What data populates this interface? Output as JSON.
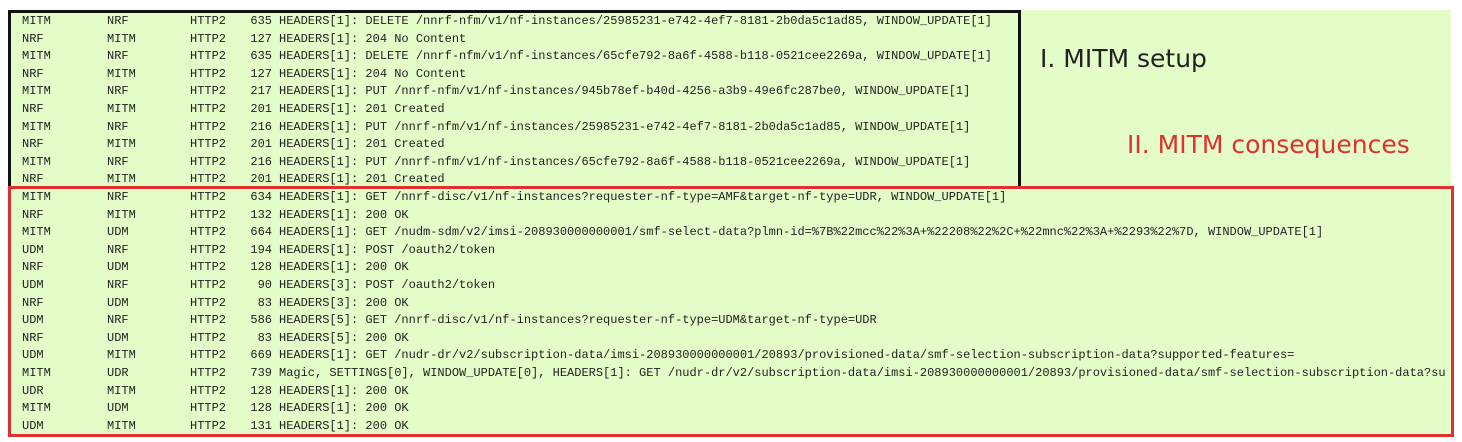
{
  "labels": {
    "setup": "I. MITM setup",
    "consequences": "II. MITM consequences"
  },
  "colors": {
    "background": "#e3fcc8",
    "setup_border": "#111111",
    "consequences_border": "#e03030"
  },
  "setup_packets": [
    {
      "src": "MITM",
      "dst": "NRF",
      "proto": "HTTP2",
      "len": "635",
      "info": "HEADERS[1]: DELETE /nnrf-nfm/v1/nf-instances/25985231-e742-4ef7-8181-2b0da5c1ad85, WINDOW_UPDATE[1]"
    },
    {
      "src": "NRF",
      "dst": "MITM",
      "proto": "HTTP2",
      "len": "127",
      "info": "HEADERS[1]: 204 No Content"
    },
    {
      "src": "MITM",
      "dst": "NRF",
      "proto": "HTTP2",
      "len": "635",
      "info": "HEADERS[1]: DELETE /nnrf-nfm/v1/nf-instances/65cfe792-8a6f-4588-b118-0521cee2269a, WINDOW_UPDATE[1]"
    },
    {
      "src": "NRF",
      "dst": "MITM",
      "proto": "HTTP2",
      "len": "127",
      "info": "HEADERS[1]: 204 No Content"
    },
    {
      "src": "MITM",
      "dst": "NRF",
      "proto": "HTTP2",
      "len": "217",
      "info": "HEADERS[1]: PUT /nnrf-nfm/v1/nf-instances/945b78ef-b40d-4256-a3b9-49e6fc287be0, WINDOW_UPDATE[1]"
    },
    {
      "src": "NRF",
      "dst": "MITM",
      "proto": "HTTP2",
      "len": "201",
      "info": "HEADERS[1]: 201 Created"
    },
    {
      "src": "MITM",
      "dst": "NRF",
      "proto": "HTTP2",
      "len": "216",
      "info": "HEADERS[1]: PUT /nnrf-nfm/v1/nf-instances/25985231-e742-4ef7-8181-2b0da5c1ad85, WINDOW_UPDATE[1]"
    },
    {
      "src": "NRF",
      "dst": "MITM",
      "proto": "HTTP2",
      "len": "201",
      "info": "HEADERS[1]: 201 Created"
    },
    {
      "src": "MITM",
      "dst": "NRF",
      "proto": "HTTP2",
      "len": "216",
      "info": "HEADERS[1]: PUT /nnrf-nfm/v1/nf-instances/65cfe792-8a6f-4588-b118-0521cee2269a, WINDOW_UPDATE[1]"
    },
    {
      "src": "NRF",
      "dst": "MITM",
      "proto": "HTTP2",
      "len": "201",
      "info": "HEADERS[1]: 201 Created"
    }
  ],
  "consequence_packets": [
    {
      "src": "MITM",
      "dst": "NRF",
      "proto": "HTTP2",
      "len": "634",
      "info": "HEADERS[1]: GET /nnrf-disc/v1/nf-instances?requester-nf-type=AMF&target-nf-type=UDR, WINDOW_UPDATE[1]"
    },
    {
      "src": "NRF",
      "dst": "MITM",
      "proto": "HTTP2",
      "len": "132",
      "info": "HEADERS[1]: 200 OK"
    },
    {
      "src": "MITM",
      "dst": "UDM",
      "proto": "HTTP2",
      "len": "664",
      "info": "HEADERS[1]: GET /nudm-sdm/v2/imsi-208930000000001/smf-select-data?plmn-id=%7B%22mcc%22%3A+%22208%22%2C+%22mnc%22%3A+%2293%22%7D, WINDOW_UPDATE[1]"
    },
    {
      "src": "UDM",
      "dst": "NRF",
      "proto": "HTTP2",
      "len": "194",
      "info": "HEADERS[1]: POST /oauth2/token"
    },
    {
      "src": "NRF",
      "dst": "UDM",
      "proto": "HTTP2",
      "len": "128",
      "info": "HEADERS[1]: 200 OK"
    },
    {
      "src": "UDM",
      "dst": "NRF",
      "proto": "HTTP2",
      "len": "90",
      "info": "HEADERS[3]: POST /oauth2/token"
    },
    {
      "src": "NRF",
      "dst": "UDM",
      "proto": "HTTP2",
      "len": "83",
      "info": "HEADERS[3]: 200 OK"
    },
    {
      "src": "UDM",
      "dst": "NRF",
      "proto": "HTTP2",
      "len": "586",
      "info": "HEADERS[5]: GET /nnrf-disc/v1/nf-instances?requester-nf-type=UDM&target-nf-type=UDR"
    },
    {
      "src": "NRF",
      "dst": "UDM",
      "proto": "HTTP2",
      "len": "83",
      "info": "HEADERS[5]: 200 OK"
    },
    {
      "src": "UDM",
      "dst": "MITM",
      "proto": "HTTP2",
      "len": "669",
      "info": "HEADERS[1]: GET /nudr-dr/v2/subscription-data/imsi-208930000000001/20893/provisioned-data/smf-selection-subscription-data?supported-features="
    },
    {
      "src": "MITM",
      "dst": "UDR",
      "proto": "HTTP2",
      "len": "739",
      "info": "Magic, SETTINGS[0], WINDOW_UPDATE[0], HEADERS[1]: GET /nudr-dr/v2/subscription-data/imsi-208930000000001/20893/provisioned-data/smf-selection-subscription-data?su"
    },
    {
      "src": "UDR",
      "dst": "MITM",
      "proto": "HTTP2",
      "len": "128",
      "info": "HEADERS[1]: 200 OK"
    },
    {
      "src": "MITM",
      "dst": "UDM",
      "proto": "HTTP2",
      "len": "128",
      "info": "HEADERS[1]: 200 OK"
    },
    {
      "src": "UDM",
      "dst": "MITM",
      "proto": "HTTP2",
      "len": "131",
      "info": "HEADERS[1]: 200 OK"
    }
  ]
}
